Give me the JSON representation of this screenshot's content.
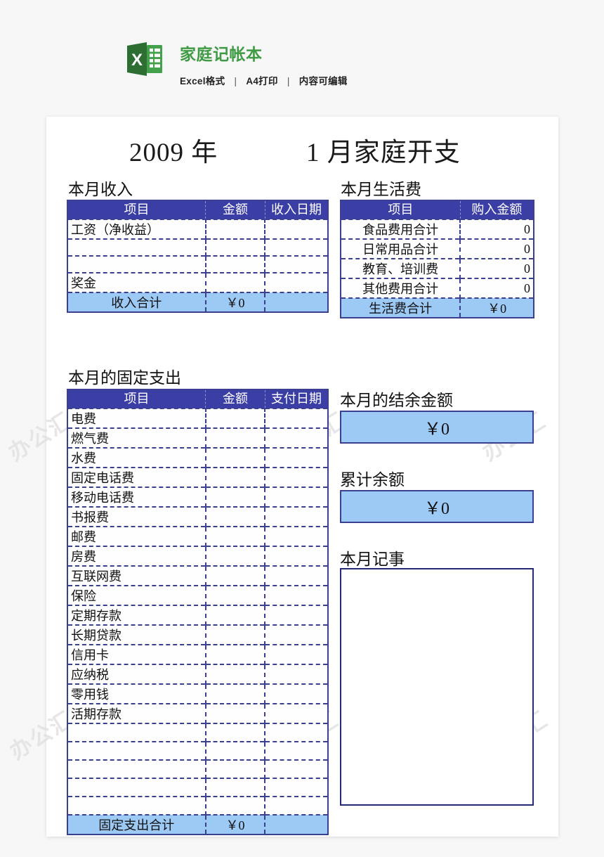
{
  "promo": {
    "icon": "excel-file-icon",
    "title": "家庭记帐本",
    "sub_items": [
      "Excel格式",
      "A4打印",
      "内容可编辑"
    ],
    "separator": "|",
    "brand_color": "#3f9b43"
  },
  "watermark": {
    "text": "办公汇"
  },
  "sheet": {
    "title": {
      "year": "2009 年",
      "month": "1 月家庭开支"
    },
    "colors": {
      "header_bg": "#3b3fa5",
      "summary_bg": "#9dc9f5",
      "border": "#3b3f8f"
    },
    "income": {
      "heading": "本月收入",
      "columns": [
        "项目",
        "金额",
        "收入日期"
      ],
      "rows": [
        {
          "item": "工资（净收益）",
          "amount": "",
          "date": ""
        },
        {
          "item": "",
          "amount": "",
          "date": ""
        },
        {
          "item": "",
          "amount": "",
          "date": ""
        },
        {
          "item": "奖金",
          "amount": "",
          "date": ""
        }
      ],
      "summary": {
        "label": "收入合计",
        "amount": "￥0",
        "date": ""
      }
    },
    "living": {
      "heading": "本月生活费",
      "columns": [
        "项目",
        "购入金额"
      ],
      "rows": [
        {
          "item": "食品费用合计",
          "amount": "0"
        },
        {
          "item": "日常用品合计",
          "amount": "0"
        },
        {
          "item": "教育、培训费",
          "amount": "0"
        },
        {
          "item": "其他费用合计",
          "amount": "0"
        }
      ],
      "summary": {
        "label": "生活费合计",
        "amount": "￥0"
      }
    },
    "fixed": {
      "heading": "本月的固定支出",
      "columns": [
        "项目",
        "金额",
        "支付日期"
      ],
      "rows": [
        {
          "item": "电费",
          "amount": "",
          "date": ""
        },
        {
          "item": "燃气费",
          "amount": "",
          "date": ""
        },
        {
          "item": "水费",
          "amount": "",
          "date": ""
        },
        {
          "item": "固定电话费",
          "amount": "",
          "date": ""
        },
        {
          "item": "移动电话费",
          "amount": "",
          "date": ""
        },
        {
          "item": "书报费",
          "amount": "",
          "date": ""
        },
        {
          "item": "邮费",
          "amount": "",
          "date": ""
        },
        {
          "item": "房费",
          "amount": "",
          "date": ""
        },
        {
          "item": "互联网费",
          "amount": "",
          "date": ""
        },
        {
          "item": "保险",
          "amount": "",
          "date": ""
        },
        {
          "item": "定期存款",
          "amount": "",
          "date": ""
        },
        {
          "item": "长期贷款",
          "amount": "",
          "date": ""
        },
        {
          "item": "信用卡",
          "amount": "",
          "date": ""
        },
        {
          "item": "应纳税",
          "amount": "",
          "date": ""
        },
        {
          "item": "零用钱",
          "amount": "",
          "date": ""
        },
        {
          "item": "活期存款",
          "amount": "",
          "date": ""
        },
        {
          "item": "",
          "amount": "",
          "date": ""
        },
        {
          "item": "",
          "amount": "",
          "date": ""
        },
        {
          "item": "",
          "amount": "",
          "date": ""
        },
        {
          "item": "",
          "amount": "",
          "date": ""
        },
        {
          "item": "",
          "amount": "",
          "date": ""
        }
      ],
      "summary": {
        "label": "固定支出合计",
        "amount": "￥0",
        "date": ""
      }
    },
    "balance": {
      "heading": "本月的结余金额",
      "value": "￥0"
    },
    "cumulative": {
      "heading": "累计余额",
      "value": "￥0"
    },
    "notes": {
      "heading": "本月记事",
      "value": ""
    }
  }
}
